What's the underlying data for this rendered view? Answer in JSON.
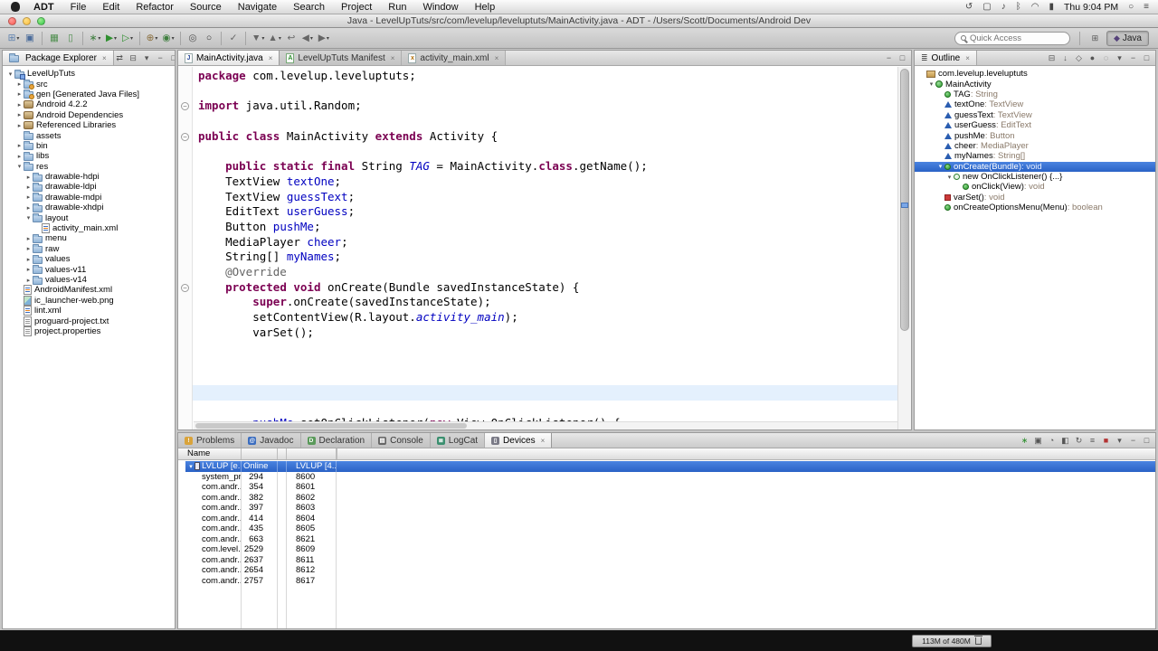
{
  "glyphs": {
    "close": "×",
    "collapsed": "▸",
    "expanded": "▾",
    "fold": "−"
  },
  "menubar": {
    "items": [
      "ADT",
      "File",
      "Edit",
      "Refactor",
      "Source",
      "Navigate",
      "Search",
      "Project",
      "Run",
      "Window",
      "Help"
    ],
    "status_icons": [
      {
        "name": "time-machine",
        "glyph": "↺"
      },
      {
        "name": "display",
        "glyph": "▢"
      },
      {
        "name": "volume",
        "glyph": "♪"
      },
      {
        "name": "bluetooth",
        "glyph": "ᛒ"
      },
      {
        "name": "wifi",
        "glyph": "◠"
      },
      {
        "name": "battery",
        "glyph": "▮"
      }
    ],
    "clock": "Thu 9:04 PM",
    "right_icons": [
      {
        "name": "spotlight",
        "glyph": "○"
      },
      {
        "name": "notification-center",
        "glyph": "≡"
      }
    ]
  },
  "window": {
    "title": "Java - LevelUpTuts/src/com/levelup/leveluptuts/MainActivity.java - ADT - /Users/Scott/Documents/Android Dev"
  },
  "toolbar": {
    "quick_access_placeholder": "Quick Access",
    "perspective_label": "Java",
    "icons": [
      {
        "name": "new-wizard",
        "glyph": "⊞",
        "color": "#5b7fae",
        "dd": true
      },
      {
        "name": "save",
        "glyph": "▣",
        "color": "#4a6b9a",
        "sep": true
      },
      {
        "name": "android-sdk-manager",
        "glyph": "▦",
        "color": "#4f8f4f"
      },
      {
        "name": "android-virtual-device-manager",
        "glyph": "▯",
        "color": "#4f8f4f",
        "sep": true
      },
      {
        "name": "debug",
        "glyph": "∗",
        "color": "#3f7f3f",
        "dd": true
      },
      {
        "name": "run",
        "glyph": "▶",
        "color": "#2e8f2e",
        "dd": true
      },
      {
        "name": "external-tools",
        "glyph": "▷",
        "color": "#2e8f2e",
        "dd": true,
        "sep": true
      },
      {
        "name": "new-java-project",
        "glyph": "⊕",
        "color": "#8a6d3b",
        "dd": true
      },
      {
        "name": "new-java-class",
        "glyph": "◉",
        "color": "#3f7f3f",
        "dd": true,
        "sep": true
      },
      {
        "name": "open-type",
        "glyph": "◎",
        "color": "#555555"
      },
      {
        "name": "search",
        "glyph": "○",
        "color": "#333333",
        "sep": true
      },
      {
        "name": "open-task",
        "glyph": "✓",
        "color": "#666666",
        "sep": true
      },
      {
        "name": "next-annotation",
        "glyph": "▼",
        "color": "#666666",
        "dd": true
      },
      {
        "name": "previous-annotation",
        "glyph": "▲",
        "color": "#666666",
        "dd": true
      },
      {
        "name": "last-edit-location",
        "glyph": "↩",
        "color": "#666666"
      },
      {
        "name": "back",
        "glyph": "◀",
        "color": "#666666",
        "dd": true
      },
      {
        "name": "forward",
        "glyph": "▶",
        "color": "#666666",
        "dd": true
      }
    ]
  },
  "package_explorer": {
    "title": "Package Explorer",
    "header_icons": [
      {
        "name": "link-with-editor",
        "glyph": "⇄"
      },
      {
        "name": "collapse-all",
        "glyph": "⊟"
      },
      {
        "name": "view-menu",
        "glyph": "▾"
      },
      {
        "name": "minimize",
        "glyph": "−"
      },
      {
        "name": "maximize",
        "glyph": "□"
      }
    ],
    "items": [
      {
        "label": "LevelUpTuts",
        "level": 0,
        "arrow": "exp",
        "icon": "project"
      },
      {
        "label": "src",
        "level": 1,
        "arrow": "col",
        "icon": "srcfolder"
      },
      {
        "label": "gen [Generated Java Files]",
        "level": 1,
        "arrow": "col",
        "icon": "srcfolder"
      },
      {
        "label": "Android 4.2.2",
        "level": 1,
        "arrow": "col",
        "icon": "library"
      },
      {
        "label": "Android Dependencies",
        "level": 1,
        "arrow": "col",
        "icon": "library"
      },
      {
        "label": "Referenced Libraries",
        "level": 1,
        "arrow": "col",
        "icon": "library"
      },
      {
        "label": "assets",
        "level": 1,
        "arrow": null,
        "icon": "folder"
      },
      {
        "label": "bin",
        "level": 1,
        "arrow": "col",
        "icon": "folder"
      },
      {
        "label": "libs",
        "level": 1,
        "arrow": "col",
        "icon": "folder"
      },
      {
        "label": "res",
        "level": 1,
        "arrow": "exp",
        "icon": "folder"
      },
      {
        "label": "drawable-hdpi",
        "level": 2,
        "arrow": "col",
        "icon": "folder"
      },
      {
        "label": "drawable-ldpi",
        "level": 2,
        "arrow": "col",
        "icon": "folder"
      },
      {
        "label": "drawable-mdpi",
        "level": 2,
        "arrow": "col",
        "icon": "folder"
      },
      {
        "label": "drawable-xhdpi",
        "level": 2,
        "arrow": "col",
        "icon": "folder"
      },
      {
        "label": "layout",
        "level": 2,
        "arrow": "exp",
        "icon": "folder"
      },
      {
        "label": "activity_main.xml",
        "level": 3,
        "arrow": null,
        "icon": "xmlfile"
      },
      {
        "label": "menu",
        "level": 2,
        "arrow": "col",
        "icon": "folder"
      },
      {
        "label": "raw",
        "level": 2,
        "arrow": "col",
        "icon": "folder"
      },
      {
        "label": "values",
        "level": 2,
        "arrow": "col",
        "icon": "folder"
      },
      {
        "label": "values-v11",
        "level": 2,
        "arrow": "col",
        "icon": "folder"
      },
      {
        "label": "values-v14",
        "level": 2,
        "arrow": "col",
        "icon": "folder"
      },
      {
        "label": "AndroidManifest.xml",
        "level": 1,
        "arrow": null,
        "icon": "xmlfile"
      },
      {
        "label": "ic_launcher-web.png",
        "level": 1,
        "arrow": null,
        "icon": "imgfile"
      },
      {
        "label": "lint.xml",
        "level": 1,
        "arrow": null,
        "icon": "xmlfile"
      },
      {
        "label": "proguard-project.txt",
        "level": 1,
        "arrow": null,
        "icon": "txtfile"
      },
      {
        "label": "project.properties",
        "level": 1,
        "arrow": null,
        "icon": "txtfile"
      }
    ]
  },
  "editor": {
    "tabs": [
      {
        "label": "MainActivity.java",
        "icon": "java-file",
        "glyph": "J",
        "active": true
      },
      {
        "label": "LevelUpTuts Manifest",
        "icon": "android-manifest",
        "glyph": "A",
        "active": false
      },
      {
        "label": "activity_main.xml",
        "icon": "xml-file",
        "glyph": "x",
        "active": false
      }
    ],
    "header_icons": [
      {
        "name": "minimize",
        "glyph": "−"
      },
      {
        "name": "maximize",
        "glyph": "□"
      }
    ],
    "highlight_line": 21,
    "fold_lines": [
      2,
      4,
      14
    ],
    "lines": [
      [
        [
          "kw",
          "package"
        ],
        [
          "pl",
          " com.levelup.leveluptuts;"
        ]
      ],
      [],
      [
        [
          "kw",
          "import"
        ],
        [
          "pl",
          " java.util.Random;"
        ]
      ],
      [],
      [
        [
          "kw",
          "public class"
        ],
        [
          "pl",
          " MainActivity "
        ],
        [
          "kw",
          "extends"
        ],
        [
          "pl",
          " Activity {"
        ]
      ],
      [],
      [
        [
          "pl",
          "    "
        ],
        [
          "kw",
          "public static final"
        ],
        [
          "pl",
          " String "
        ],
        [
          "sf",
          "TAG"
        ],
        [
          "pl",
          " = MainActivity."
        ],
        [
          "kw",
          "class"
        ],
        [
          "pl",
          ".getName();"
        ]
      ],
      [
        [
          "pl",
          "    TextView "
        ],
        [
          "fld",
          "textOne"
        ],
        [
          "pl",
          ";"
        ]
      ],
      [
        [
          "pl",
          "    TextView "
        ],
        [
          "fld",
          "guessText"
        ],
        [
          "pl",
          ";"
        ]
      ],
      [
        [
          "pl",
          "    EditText "
        ],
        [
          "fld",
          "userGuess"
        ],
        [
          "pl",
          ";"
        ]
      ],
      [
        [
          "pl",
          "    Button "
        ],
        [
          "fld",
          "pushMe"
        ],
        [
          "pl",
          ";"
        ]
      ],
      [
        [
          "pl",
          "    MediaPlayer "
        ],
        [
          "fld",
          "cheer"
        ],
        [
          "pl",
          ";"
        ]
      ],
      [
        [
          "pl",
          "    String[] "
        ],
        [
          "fld",
          "myNames"
        ],
        [
          "pl",
          ";"
        ]
      ],
      [
        [
          "an",
          "    @Override"
        ]
      ],
      [
        [
          "pl",
          "    "
        ],
        [
          "kw",
          "protected void"
        ],
        [
          "pl",
          " onCreate(Bundle savedInstanceState) {"
        ]
      ],
      [
        [
          "pl",
          "        "
        ],
        [
          "kw",
          "super"
        ],
        [
          "pl",
          ".onCreate(savedInstanceState);"
        ]
      ],
      [
        [
          "pl",
          "        setContentView(R.layout."
        ],
        [
          "sf",
          "activity_main"
        ],
        [
          "pl",
          ");"
        ]
      ],
      [
        [
          "pl",
          "        varSet();"
        ]
      ],
      [],
      [],
      [],
      [],
      [],
      [
        [
          "pl",
          "        "
        ],
        [
          "fld",
          "pushMe"
        ],
        [
          "pl",
          ".setOnClickListener("
        ],
        [
          "kw",
          "new"
        ],
        [
          "pl",
          " View.OnClickListener() {"
        ]
      ]
    ]
  },
  "outline": {
    "title": "Outline",
    "header_icons": [
      {
        "name": "collapse-all",
        "glyph": "⊟"
      },
      {
        "name": "sort",
        "glyph": "↓"
      },
      {
        "name": "hide-fields",
        "glyph": "◇"
      },
      {
        "name": "hide-static-members",
        "glyph": "●"
      },
      {
        "name": "hide-non-public",
        "glyph": "◌"
      },
      {
        "name": "view-menu",
        "glyph": "▾"
      },
      {
        "name": "minimize",
        "glyph": "−"
      },
      {
        "name": "maximize",
        "glyph": "□"
      }
    ],
    "items": [
      {
        "name": "com.levelup.leveluptuts",
        "type": null,
        "level": 0,
        "icon": "package",
        "arrow": null
      },
      {
        "name": "MainActivity",
        "type": null,
        "level": 1,
        "icon": "class",
        "arrow": "exp"
      },
      {
        "name": "TAG",
        "type": "String",
        "level": 2,
        "icon": "field-public",
        "arrow": null
      },
      {
        "name": "textOne",
        "type": "TextView",
        "level": 2,
        "icon": "field-default",
        "arrow": null
      },
      {
        "name": "guessText",
        "type": "TextView",
        "level": 2,
        "icon": "field-default",
        "arrow": null
      },
      {
        "name": "userGuess",
        "type": "EditText",
        "level": 2,
        "icon": "field-default",
        "arrow": null
      },
      {
        "name": "pushMe",
        "type": "Button",
        "level": 2,
        "icon": "field-default",
        "arrow": null
      },
      {
        "name": "cheer",
        "type": "MediaPlayer",
        "level": 2,
        "icon": "field-default",
        "arrow": null
      },
      {
        "name": "myNames",
        "type": "String[]",
        "level": 2,
        "icon": "field-default",
        "arrow": null
      },
      {
        "name": "onCreate(Bundle)",
        "type": "void",
        "level": 2,
        "icon": "method-protected",
        "arrow": "exp",
        "selected": true
      },
      {
        "name": "new OnClickListener() {...}",
        "type": null,
        "level": 3,
        "icon": "inner-class",
        "arrow": "exp"
      },
      {
        "name": "onClick(View)",
        "type": "void",
        "level": 4,
        "icon": "method-public",
        "arrow": null
      },
      {
        "name": "varSet()",
        "type": "void",
        "level": 2,
        "icon": "method-private",
        "arrow": null
      },
      {
        "name": "onCreateOptionsMenu(Menu)",
        "type": "boolean",
        "level": 2,
        "icon": "method-public",
        "arrow": null
      }
    ]
  },
  "bottom": {
    "tabs": [
      {
        "label": "Problems",
        "icon": "problems",
        "glyph": "!",
        "active": false
      },
      {
        "label": "Javadoc",
        "icon": "javadoc",
        "glyph": "@",
        "active": false
      },
      {
        "label": "Declaration",
        "icon": "declaration",
        "glyph": "D",
        "active": false
      },
      {
        "label": "Console",
        "icon": "console",
        "glyph": "▤",
        "active": false
      },
      {
        "label": "LogCat",
        "icon": "logcat",
        "glyph": "≣",
        "active": false
      },
      {
        "label": "Devices",
        "icon": "devices",
        "glyph": "▯",
        "active": true,
        "closable": true
      }
    ],
    "header_icons": [
      {
        "name": "debug-attach",
        "glyph": "∗",
        "color": "#2e8f2e"
      },
      {
        "name": "screen-capture",
        "glyph": "▣"
      },
      {
        "name": "update-heap",
        "glyph": "◔"
      },
      {
        "name": "dump-hprof",
        "glyph": "◧"
      },
      {
        "name": "cause-gc",
        "glyph": "↻"
      },
      {
        "name": "update-threads",
        "glyph": "≡"
      },
      {
        "name": "stop-process",
        "glyph": "■",
        "color": "#b33333"
      },
      {
        "name": "view-menu",
        "glyph": "▾"
      },
      {
        "name": "minimize",
        "glyph": "−"
      },
      {
        "name": "maximize",
        "glyph": "□"
      }
    ],
    "devices": {
      "header": "Name",
      "rows": [
        {
          "name": "LVLUP [e...",
          "c2": "Online",
          "c3": "LVLUP [4...",
          "selected": true,
          "device": true
        },
        {
          "name": "system_pr...",
          "c2": "294",
          "c3": "8600"
        },
        {
          "name": "com.andr...",
          "c2": "354",
          "c3": "8601"
        },
        {
          "name": "com.andr...",
          "c2": "382",
          "c3": "8602"
        },
        {
          "name": "com.andr...",
          "c2": "397",
          "c3": "8603"
        },
        {
          "name": "com.andr...",
          "c2": "414",
          "c3": "8604"
        },
        {
          "name": "com.andr...",
          "c2": "435",
          "c3": "8605"
        },
        {
          "name": "com.andr...",
          "c2": "663",
          "c3": "8621"
        },
        {
          "name": "com.level...",
          "c2": "2529",
          "c3": "8609"
        },
        {
          "name": "com.andr...",
          "c2": "2637",
          "c3": "8611"
        },
        {
          "name": "com.andr...",
          "c2": "2654",
          "c3": "8612"
        },
        {
          "name": "com.andr...",
          "c2": "2757",
          "c3": "8617"
        }
      ]
    }
  },
  "statusbar": {
    "memory": "113M of 480M"
  }
}
